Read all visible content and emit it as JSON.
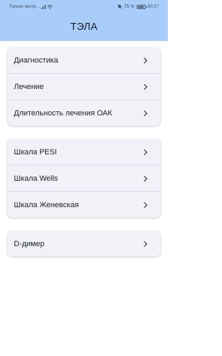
{
  "status_bar": {
    "carrier": "Только экстр...",
    "battery": "75 %",
    "time": "00:17"
  },
  "header": {
    "title": "ТЭЛА"
  },
  "groups": [
    {
      "items": [
        "Диагностика",
        "Лечение",
        "Длительность лечения ОАК"
      ]
    },
    {
      "items": [
        "Шкала PESI",
        "Шкала Wells",
        "Шкала Женевская"
      ]
    },
    {
      "items": [
        "D-димер"
      ]
    }
  ],
  "icons": [
    "sim-icon",
    "wifi-icon",
    "mute-icon",
    "battery-icon",
    "chevron-right-icon"
  ],
  "colors": {
    "header_bg": "#a9cdfb",
    "card_bg": "#f0f2f7"
  }
}
